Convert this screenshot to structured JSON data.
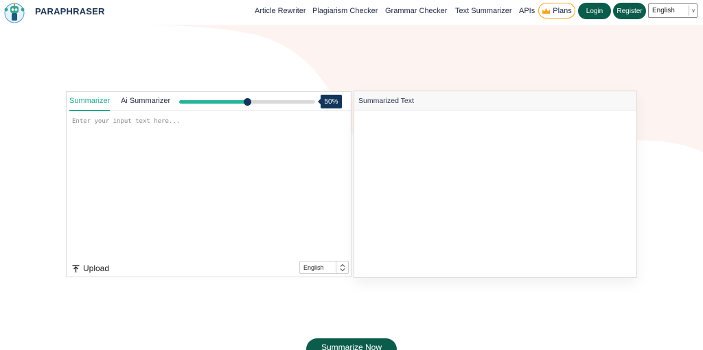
{
  "brand": {
    "name": "PARAPHRASER"
  },
  "nav": {
    "links": [
      "Article Rewriter",
      "Plagiarism Checker",
      "Grammar Checker",
      "Text Summarizer",
      "APIs"
    ],
    "plans_label": "Plans",
    "login_label": "Login",
    "register_label": "Register",
    "language": "English"
  },
  "summarizer": {
    "tabs": [
      "Summarizer",
      "Ai Summarizer"
    ],
    "active_tab": "Summarizer",
    "slider_percent": 50,
    "slider_label": "50%",
    "input_placeholder": "Enter your input text here...",
    "upload_label": "Upload",
    "language": "English",
    "output_title": "Summarized Text",
    "submit_label": "Summarize Now"
  },
  "colors": {
    "primary": "#0b5c4b",
    "accent": "#22a98f",
    "slider_thumb": "#12355b",
    "plans_border": "#f5a524",
    "background_blob": "#fdf3f1"
  },
  "icons": {
    "logo": "robot-mascot-icon",
    "plans": "crown-icon",
    "upload": "upload-arrow-icon",
    "language_select": "chevron-down-icon",
    "language_spinner": "spinner-arrows-icon"
  }
}
